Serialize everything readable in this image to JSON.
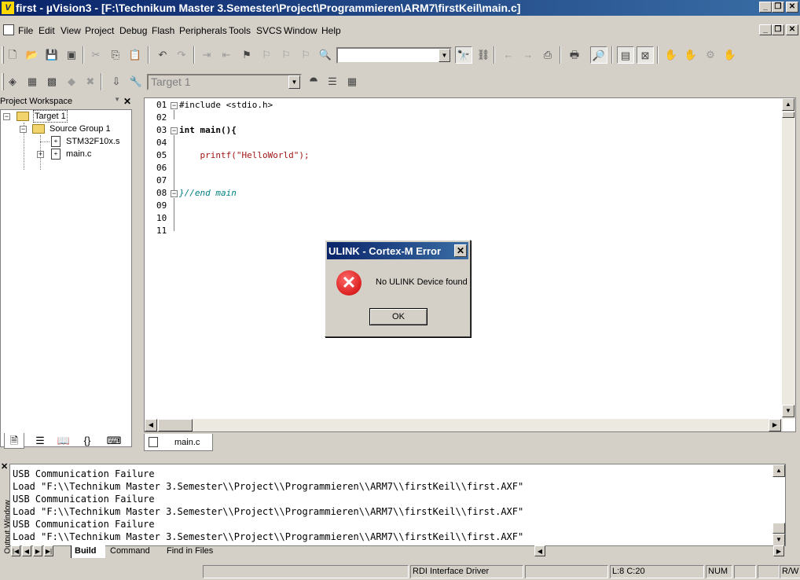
{
  "window": {
    "title": "first  - µVision3 - [F:\\Technikum Master 3.Semester\\Project\\Programmieren\\ARM7\\firstKeil\\main.c]",
    "app_icon": "V"
  },
  "menu": [
    "File",
    "Edit",
    "View",
    "Project",
    "Debug",
    "Flash",
    "Peripherals",
    "Tools",
    "SVCS",
    "Window",
    "Help"
  ],
  "toolbar": {
    "find_value": "",
    "target_value": "Target 1"
  },
  "workspace": {
    "title": "Project Workspace",
    "tree": {
      "target": "Target 1",
      "group": "Source Group 1",
      "files": [
        "STM32F10x.s",
        "main.c"
      ]
    }
  },
  "editor": {
    "lines": [
      {
        "num": "01",
        "text": "#include <stdio.h>"
      },
      {
        "num": "02",
        "text": ""
      },
      {
        "num": "03",
        "text": "int main(){"
      },
      {
        "num": "04",
        "text": ""
      },
      {
        "num": "05",
        "text": "    printf(\"HelloWorld\");"
      },
      {
        "num": "06",
        "text": ""
      },
      {
        "num": "07",
        "text": ""
      },
      {
        "num": "08",
        "text": "}//end main"
      },
      {
        "num": "09",
        "text": ""
      },
      {
        "num": "10",
        "text": ""
      },
      {
        "num": "11",
        "text": ""
      }
    ],
    "tab_label": "main.c"
  },
  "output": {
    "side_label": "Output Window",
    "lines": [
      "USB Communication Failure",
      "Load \"F:\\\\Technikum Master 3.Semester\\\\Project\\\\Programmieren\\\\ARM7\\\\firstKeil\\\\first.AXF\"",
      "USB Communication Failure",
      "Load \"F:\\\\Technikum Master 3.Semester\\\\Project\\\\Programmieren\\\\ARM7\\\\firstKeil\\\\first.AXF\"",
      "USB Communication Failure",
      "Load \"F:\\\\Technikum Master 3.Semester\\\\Project\\\\Programmieren\\\\ARM7\\\\firstKeil\\\\first.AXF\""
    ],
    "tabs": [
      "Build",
      "Command",
      "Find in Files"
    ]
  },
  "status": {
    "driver": "RDI Interface Driver",
    "position": "L:8 C:20",
    "num": "NUM",
    "rw": "R/W"
  },
  "dialog": {
    "title": "ULINK - Cortex-M Error",
    "message": "No ULINK Device found",
    "ok_label": "OK",
    "close_glyph": "✕",
    "error_glyph": "✕"
  },
  "colors": {
    "title_bar": "#0a246a",
    "keyword": "#000000",
    "string": "#a31515",
    "comment": "#008080"
  }
}
